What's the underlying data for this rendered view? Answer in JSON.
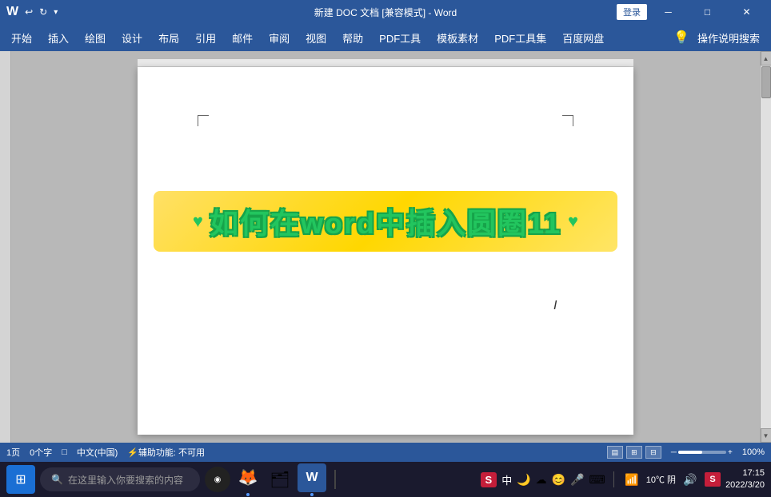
{
  "titlebar": {
    "title": "新建 DOC 文档 [兼容模式] - Word",
    "login_btn": "登录",
    "quick_access": [
      "↩",
      "↻"
    ],
    "controls": [
      "─",
      "□",
      "✕"
    ]
  },
  "ribbon": {
    "tabs": [
      "开始",
      "插入",
      "绘图",
      "设计",
      "布局",
      "引用",
      "邮件",
      "审阅",
      "视图",
      "帮助",
      "PDF工具",
      "模板素材",
      "PDF工具集",
      "百度网盘"
    ]
  },
  "search": {
    "placeholder": "操作说明搜索",
    "icon": "🔍"
  },
  "banner": {
    "text": "如何在word中插入圆圈11",
    "deco_left": "♥",
    "deco_right": "♥"
  },
  "status": {
    "page": "1页",
    "words": "0个字",
    "doc_icon": "□",
    "lang": "中文(中国)",
    "accessibility": "辅助功能: 不可用",
    "zoom": "100%"
  },
  "taskbar": {
    "search_placeholder": "在这里输入你要搜索的内容",
    "apps": [
      "⚫",
      "🔥",
      "🗂",
      "W"
    ],
    "weather": "10℃ 阴",
    "time": "17:15",
    "date": "2022/3/20"
  },
  "ime": {
    "label": "中",
    "icons": [
      "🌙",
      "☁",
      "🎤",
      "⌨"
    ]
  }
}
